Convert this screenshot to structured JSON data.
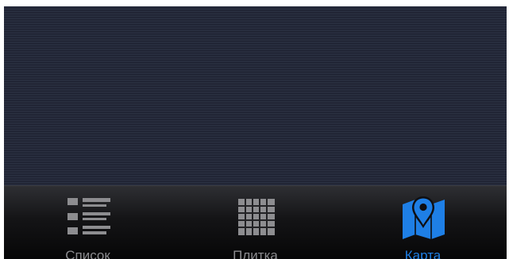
{
  "tab_bar": {
    "selected": "map",
    "tabs": [
      {
        "id": "list",
        "label": "Список",
        "icon": "list-icon"
      },
      {
        "id": "grid",
        "label": "Плитка",
        "icon": "grid-icon"
      },
      {
        "id": "map",
        "label": "Карта",
        "icon": "map-pin-icon"
      }
    ]
  },
  "colors": {
    "active": "#1e7fe6",
    "inactive": "#8b8b8f",
    "background": "#262b3a"
  }
}
